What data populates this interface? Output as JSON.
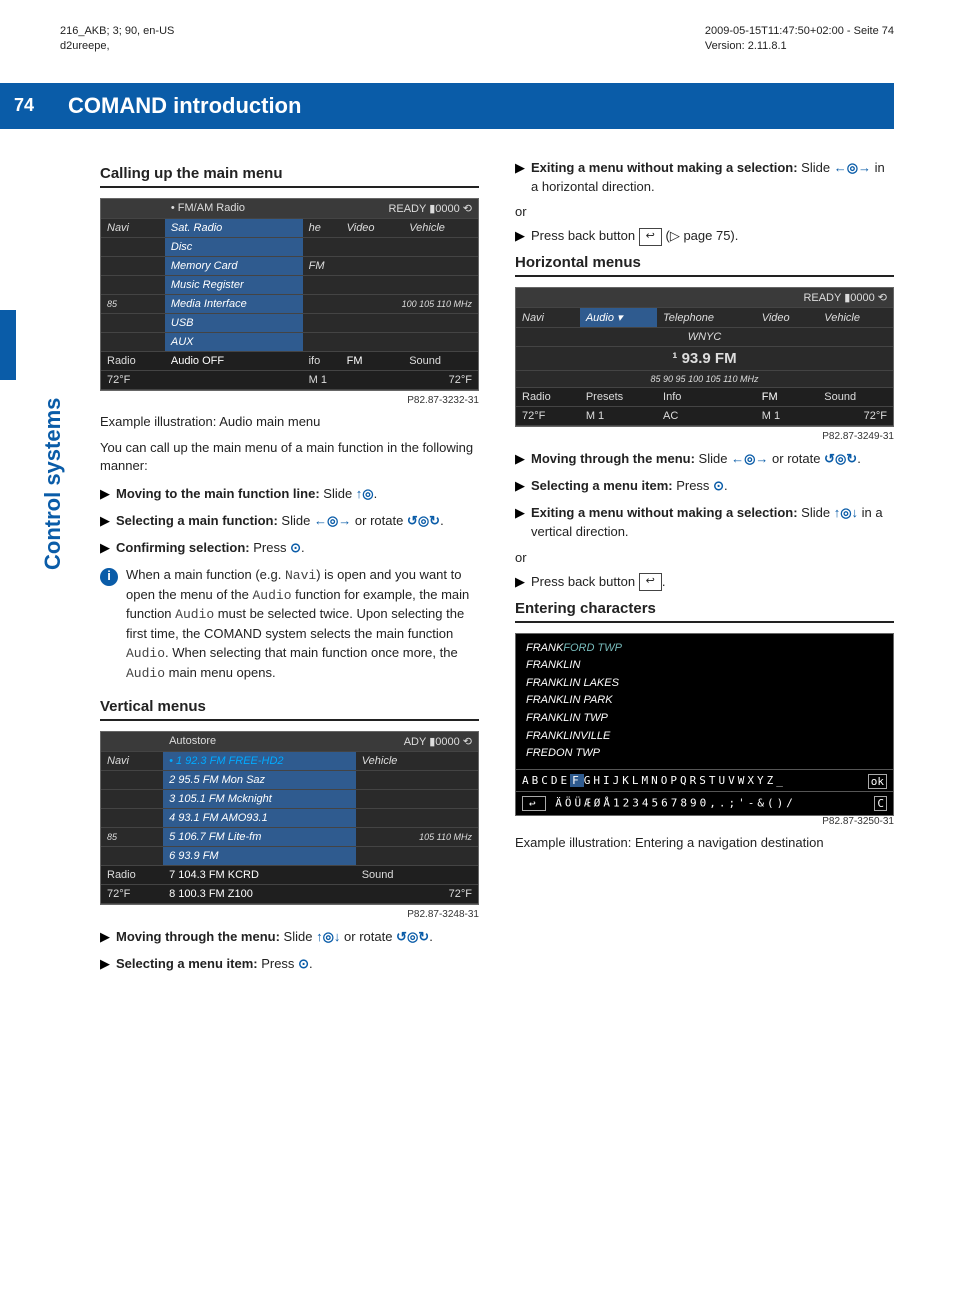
{
  "meta": {
    "left_line1": "216_AKB; 3; 90, en-US",
    "left_line2": "d2ureepe,",
    "right_line1": "2009-05-15T11:47:50+02:00 - Seite 74",
    "right_line2": "Version: 2.11.8.1"
  },
  "chapter": {
    "page_num": "74",
    "title": "COMAND introduction"
  },
  "side_tab": "Control systems",
  "left": {
    "h1": "Calling up the main menu",
    "img1": {
      "topbar_label": "• FM/AM Radio",
      "ready": "READY ▮0000 ⟲",
      "row_navi": "Navi",
      "row_sat": "Sat. Radio",
      "row_video": "Video",
      "row_vehicle": "Vehicle",
      "row_disc": "Disc",
      "row_mem": "Memory Card",
      "row_fm": "FM",
      "row_music": "Music Register",
      "row_media": "Media Interface",
      "row_usb": "USB",
      "scale": "100    105    110 MHz",
      "row_aux": "AUX",
      "row_radio": "Radio",
      "row_audio_off": "Audio OFF",
      "row_ifo": "ifo",
      "row_fm2": "FM",
      "row_sound": "Sound",
      "row_72": "72°F",
      "row_m1": "M 1",
      "row_72b": "72°F",
      "ref": "P82.87-3232-31"
    },
    "caption1": "Example illustration: Audio main menu",
    "para1": "You can call up the main menu of a main function in the following manner:",
    "step1_b": "Moving to the main function line:",
    "step1_t": " Slide ",
    "step1_g": "↑◎",
    "step1_e": ".",
    "step2_b": "Selecting a main function:",
    "step2_t": " Slide ",
    "step2_g1": "←◎→",
    "step2_or": " or rotate ",
    "step2_g2": "↺◎↻",
    "step2_e": ".",
    "step3_b": "Confirming selection:",
    "step3_t": " Press ",
    "step3_g": "⊙",
    "step3_e": ".",
    "info": {
      "t1": "When a main function (e.g. ",
      "navi": "Navi",
      "t2": ") is open and you want to open the menu of the ",
      "audio1": "Audio",
      "t3": " function for example, the main function ",
      "audio2": "Audio",
      "t4": " must be selected twice. Upon selecting the first time, the COMAND system selects the main function ",
      "audio3": "Audio",
      "t5": ". When selecting that main function once more, the ",
      "audio4": "Audio",
      "t6": " main menu opens."
    },
    "h2": "Vertical menus",
    "img2": {
      "topbar_label": "Autostore",
      "ready": "ADY ▮0000 ⟲",
      "row_navi": "Navi",
      "r1": "• 1  92.3 FM FREE-HD2",
      "r1b": "Vehicle",
      "r2": "2  95.5 FM  Mon Saz",
      "r3": "3  105.1 FM  Mcknight",
      "r4": "4  93.1 FM  AMO93.1",
      "r5": "5  106.7 FM  Lite-fm",
      "r5b": "105    110 MHz",
      "r6": "6  93.9 FM",
      "row_radio": "Radio",
      "r7": "7  104.3 FM  KCRD",
      "row_sound": "Sound",
      "row_72": "72°F",
      "r8": "8  100.3 FM  Z100",
      "row_72b": "72°F",
      "ref": "P82.87-3248-31"
    },
    "step4_b": "Moving through the menu:",
    "step4_t": " Slide ",
    "step4_g1": "↑◎↓",
    "step4_or": " or rotate ",
    "step4_g2": "↺◎↻",
    "step4_e": ".",
    "step5_b": "Selecting a menu item:",
    "step5_t": " Press ",
    "step5_g": "⊙",
    "step5_e": "."
  },
  "right": {
    "step1_b": "Exiting a menu without making a selection:",
    "step1_t": " Slide ",
    "step1_g": "←◎→",
    "step1_e": " in a horizontal direction.",
    "or": "or",
    "step2_t1": "Press back button ",
    "step2_btn": "↩",
    "step2_t2": " (▷ page 75).",
    "h1": "Horizontal menus",
    "img1": {
      "ready": "READY ▮0000 ⟲",
      "row_navi": "Navi",
      "row_audio": "Audio ▾",
      "row_tel": "Telephone",
      "row_video": "Video",
      "row_vehicle": "Vehicle",
      "wnyc": "WNYC",
      "freq": "¹ 93.9 FM",
      "scale": "85    90    95    100    105    110 MHz",
      "row_radio": "Radio",
      "row_presets": "Presets",
      "row_info": "Info",
      "row_fm": "FM",
      "row_sound": "Sound",
      "row_72": "72°F",
      "row_m1": "M 1",
      "row_ac": "AC",
      "row_m1b": "M 1",
      "row_72b": "72°F",
      "ref": "P82.87-3249-31"
    },
    "step3_b": "Moving through the menu:",
    "step3_t": " Slide ",
    "step3_g1": "←◎→",
    "step3_or": " or rotate ",
    "step3_g2": "↺◎↻",
    "step3_e": ".",
    "step4_b": "Selecting a menu item:",
    "step4_t": " Press ",
    "step4_g": "⊙",
    "step4_e": ".",
    "step5_b": "Exiting a menu without making a selection:",
    "step5_t": " Slide ",
    "step5_g": "↑◎↓",
    "step5_e": " in a vertical direction.",
    "or2": "or",
    "step6_t1": "Press back button ",
    "step6_btn": "↩",
    "step6_e": ".",
    "h2": "Entering characters",
    "img2": {
      "l0a": "FRANK",
      "l0b": "FORD TWP",
      "l1": "FRANKLIN",
      "l2": "FRANKLIN LAKES",
      "l3": "FRANKLIN PARK",
      "l4": "FRANKLIN TWP",
      "l5": "FRANKLINVILLE",
      "l6": "FREDON TWP",
      "row1a": "ABCDE",
      "row1f": "F",
      "row1b": "GHIJKLMNOPQRSTUVWXYZ_",
      "row1ok": "ok",
      "row2_btn": "↩",
      "row2": "ÄÖÜÆØÅ1234567890,.;'-&()/",
      "row2c": "C",
      "ref": "P82.87-3250-31"
    },
    "caption2": "Example illustration: Entering a navigation destination"
  }
}
